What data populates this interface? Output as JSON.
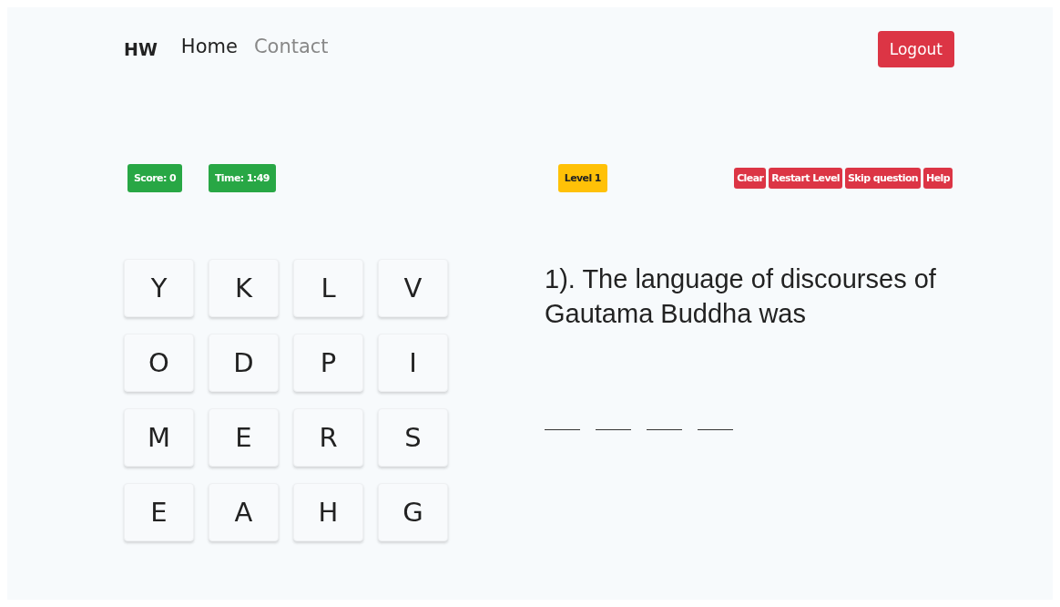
{
  "nav": {
    "brand": "HW",
    "links": [
      {
        "label": "Home",
        "selected": true
      },
      {
        "label": "Contact",
        "selected": false
      }
    ],
    "logout": "Logout"
  },
  "status": {
    "score": "Score: 0",
    "time": "Time: 1:49",
    "level": "Level 1",
    "actions": [
      "Clear",
      "Restart Level",
      "Skip question",
      "Help"
    ]
  },
  "grid": [
    "Y",
    "K",
    "L",
    "V",
    "O",
    "D",
    "P",
    "I",
    "M",
    "E",
    "R",
    "S",
    "E",
    "A",
    "H",
    "G"
  ],
  "question": "1). The language of discourses of Gautama Buddha was",
  "answer_blanks": [
    {
      "filled": false
    },
    {
      "filled": false
    },
    {
      "filled": false
    },
    {
      "filled": false
    }
  ]
}
